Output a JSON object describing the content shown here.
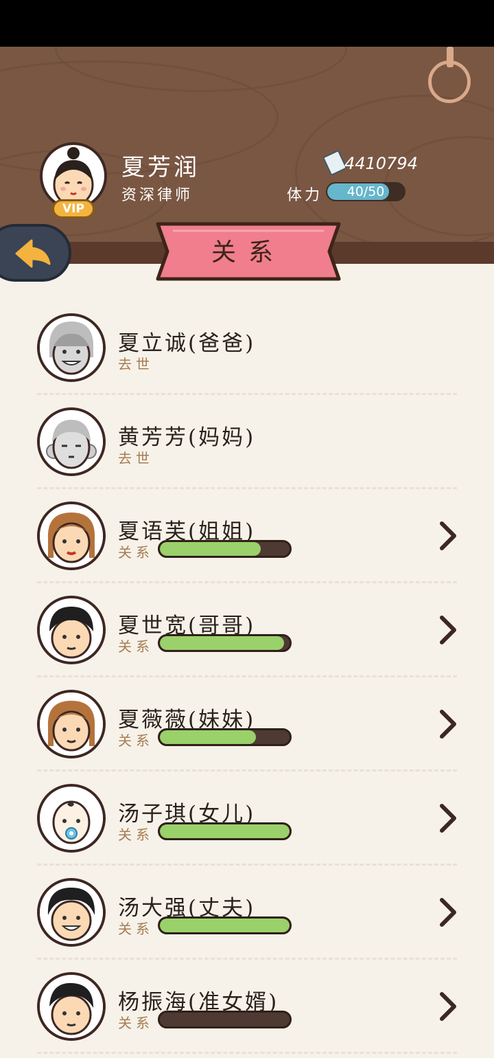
{
  "player": {
    "name": "夏芳润",
    "title": "资深律师",
    "vip_label": "VIP",
    "money": "4410794",
    "stamina_label": "体力",
    "stamina_text": "40/50",
    "stamina_fraction": 0.8
  },
  "page_title": "关系",
  "relation_label": "关系",
  "colors": {
    "header_wood": "#7a5743",
    "ribbon": "#f07e8c",
    "bar_fill": "#9ad16a",
    "stamina_fill": "#66b6cc"
  },
  "relatives": [
    {
      "name": "夏立诚(爸爸)",
      "status": "去世",
      "deceased": true
    },
    {
      "name": "黄芳芳(妈妈)",
      "status": "去世",
      "deceased": true
    },
    {
      "name": "夏语芙(姐姐)",
      "relation": 0.78
    },
    {
      "name": "夏世宽(哥哥)",
      "relation": 0.96
    },
    {
      "name": "夏薇薇(妹妹)",
      "relation": 0.74
    },
    {
      "name": "汤子琪(女儿)",
      "relation": 1.0
    },
    {
      "name": "汤大强(丈夫)",
      "relation": 1.0
    },
    {
      "name": "杨振海(准女婿)",
      "relation": 0.0
    }
  ]
}
